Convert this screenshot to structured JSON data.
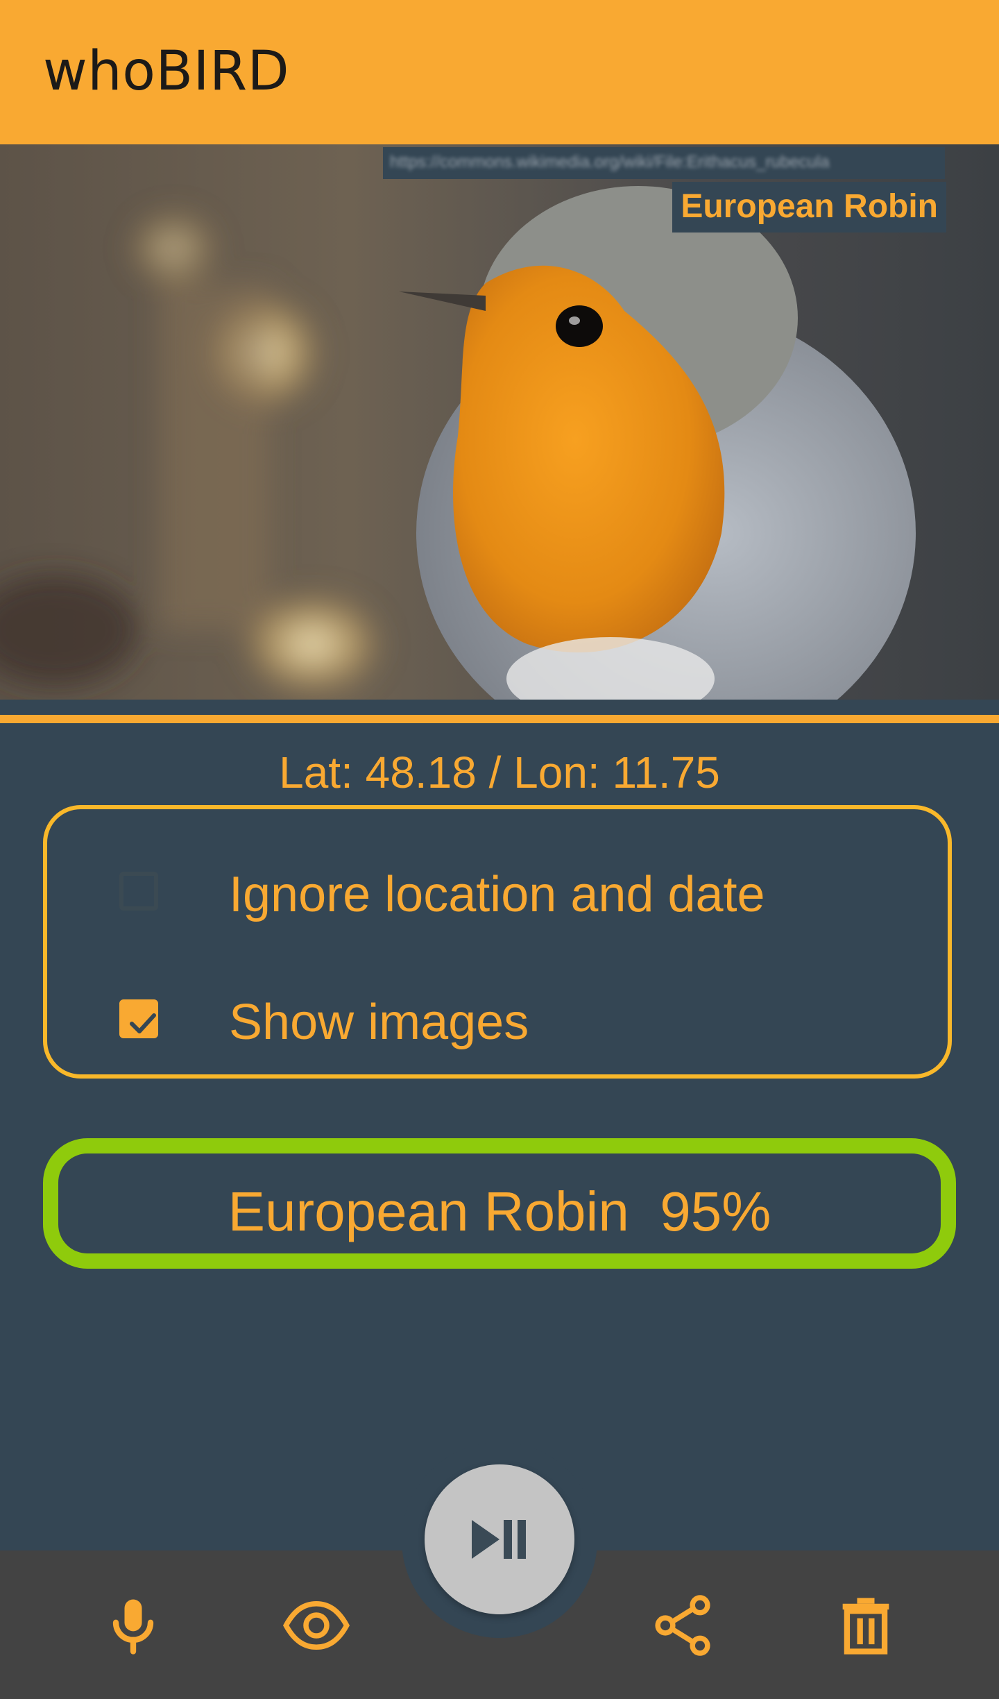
{
  "app": {
    "title": "whoBIRD"
  },
  "photo": {
    "source_url": "https://commons.wikimedia.org/wiki/File:Erithacus_rubecula",
    "caption": "European Robin"
  },
  "playback": {
    "progress": 1.0
  },
  "location": {
    "text": "Lat: 48.18 / Lon: 11.75"
  },
  "options": {
    "ignore_location": {
      "label": "Ignore location and date",
      "checked": false
    },
    "show_images": {
      "label": "Show images",
      "checked": true
    }
  },
  "result": {
    "text": "European Robin  95%",
    "species": "European Robin",
    "confidence": "95%"
  },
  "bottom_nav": {
    "items": [
      {
        "icon": "microphone-icon"
      },
      {
        "icon": "eye-icon"
      },
      {
        "icon": "share-icon"
      },
      {
        "icon": "trash-icon"
      }
    ],
    "fab_icon": "play-pause-icon"
  },
  "colors": {
    "accent": "#f9a932",
    "background": "#344654",
    "result_border": "#8fcb0c",
    "bottom_bar": "#434343",
    "fab": "#c4c4c4"
  }
}
